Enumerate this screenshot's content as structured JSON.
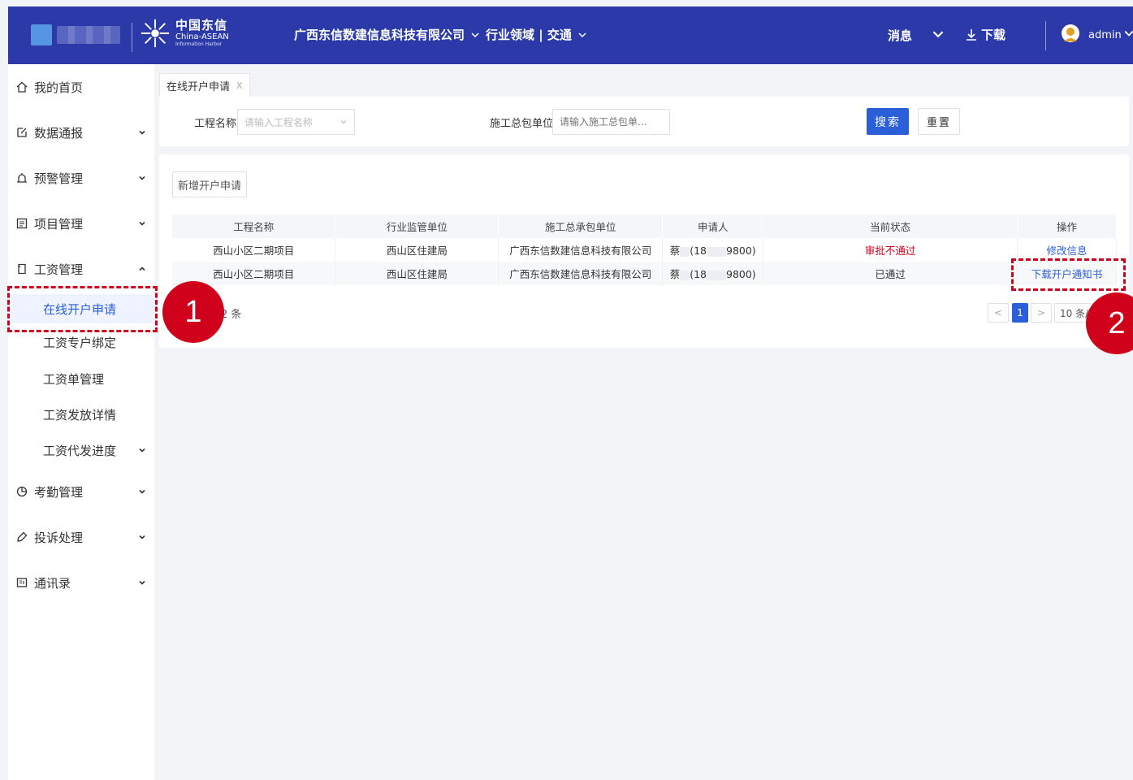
{
  "header": {
    "brand_cn": "中国东信",
    "brand_en": "China-ASEAN",
    "brand_sub": "Information Harbor",
    "company": "广西东信数建信息科技有限公司",
    "domain": "行业领域 | 交通",
    "messages": "消息",
    "download": "下载",
    "user": "admin",
    "bg_color": "#2b3aa8"
  },
  "sidebar": {
    "items": [
      {
        "label": "我的首页",
        "icon": "home-icon"
      },
      {
        "label": "数据通报",
        "icon": "edit-icon"
      },
      {
        "label": "预警管理",
        "icon": "alarm-icon"
      },
      {
        "label": "项目管理",
        "icon": "list-icon"
      },
      {
        "label": "工资管理",
        "icon": "wallet-icon"
      }
    ],
    "sub_items": [
      {
        "label": "在线开户申请"
      },
      {
        "label": "工资专户绑定"
      },
      {
        "label": "工资单管理"
      },
      {
        "label": "工资发放详情"
      },
      {
        "label": "工资代发进度"
      }
    ],
    "items_bottom": [
      {
        "label": "考勤管理",
        "icon": "pie-chart-icon"
      },
      {
        "label": "投诉处理",
        "icon": "complaint-icon"
      },
      {
        "label": "通讯录",
        "icon": "contacts-icon"
      }
    ],
    "active_color": "#2b5fd9"
  },
  "tabs": {
    "current": "在线开户申请",
    "close": "X"
  },
  "search": {
    "project_label": "工程名称",
    "project_placeholder": "请输入工程名称",
    "contractor_label": "施工总包单位",
    "contractor_placeholder": "请输入施工总包单...",
    "search_btn": "搜索",
    "reset_btn": "重置"
  },
  "list": {
    "new_btn": "新增开户申请",
    "columns": [
      "工程名称",
      "行业监管单位",
      "施工总承包单位",
      "申请人",
      "当前状态",
      "操作"
    ],
    "rows": [
      {
        "project": "西山小区二期项目",
        "regulator": "西山区住建局",
        "contractor": "广西东信数建信息科技有限公司",
        "applicant_a": "蔡",
        "applicant_b": "(18",
        "applicant_c": "9800)",
        "status": "审批不通过",
        "action": "修改信息"
      },
      {
        "project": "西山小区二期项目",
        "regulator": "西山区住建局",
        "contractor": "广西东信数建信息科技有限公司",
        "applicant_a": "蔡",
        "applicant_b": "(18",
        "applicant_c": "9800)",
        "status": "已通过",
        "action": "下载开户通知书"
      }
    ],
    "total_suffix": "2 条",
    "prev": "<",
    "current_page": "1",
    "next": ">",
    "page_size": "10 条/页"
  },
  "annotations": {
    "badge1": "1",
    "badge2": "2",
    "color": "#d0021b"
  }
}
